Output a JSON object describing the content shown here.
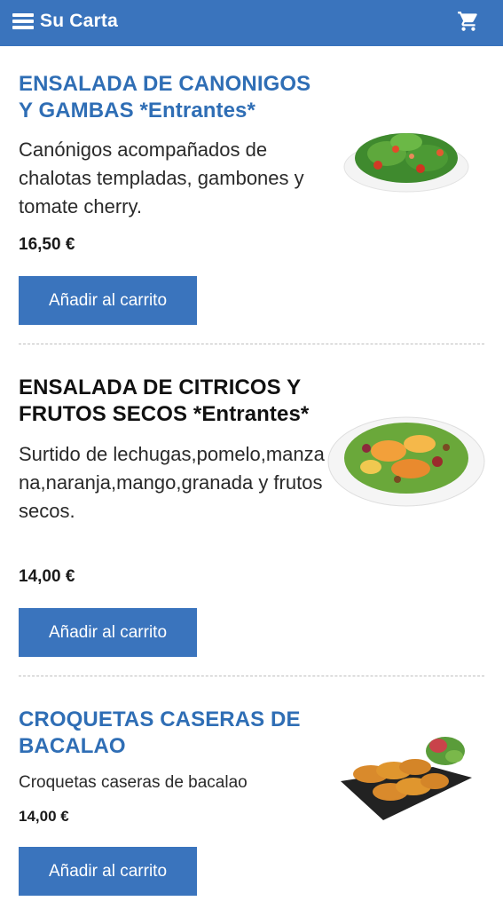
{
  "header": {
    "title": "Su Carta",
    "menu_icon": "hamburger-menu-icon",
    "cart_icon": "shopping-cart-icon",
    "bar_color": "#3a74bd"
  },
  "items": [
    {
      "title_line1": "ENSALADA DE CANONIGOS",
      "title_line2": "Y GAMBAS *Entrantes*",
      "description": "Canónigos acompañados de chalotas templadas, gambones y tomate cherry.",
      "price": "16,50 €",
      "button_label": "Añadir al carrito",
      "image": "salad-canonigos-image"
    },
    {
      "title_line1": "ENSALADA DE CITRICOS Y",
      "title_line2": "FRUTOS SECOS *Entrantes*",
      "description": "Surtido de lechugas,pomelo,manzana,naranja,mango,granada y frutos secos.",
      "price": "14,00 €",
      "button_label": "Añadir al carrito",
      "image": "salad-citricos-image"
    },
    {
      "title_line1": "CROQUETAS CASERAS DE",
      "title_line2": "BACALAO",
      "description": "Croquetas caseras de bacalao",
      "price": "14,00 €",
      "button_label": "Añadir al carrito",
      "image": "croquetas-image"
    }
  ],
  "colors": {
    "accent": "#3a74bd",
    "title_blue": "#2f6eb5"
  }
}
